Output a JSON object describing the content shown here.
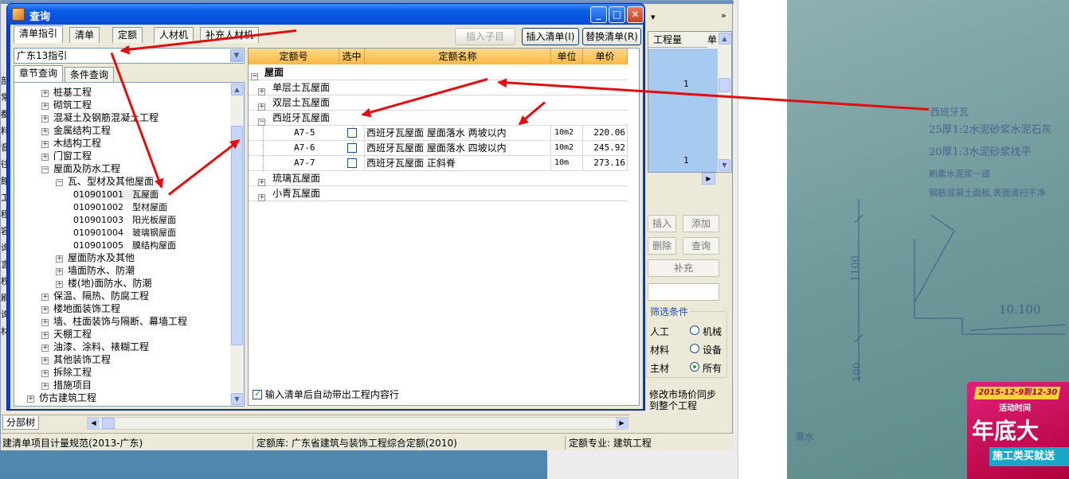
{
  "dialog": {
    "title": "查询",
    "tabs": [
      "清单指引",
      "清单",
      "定额",
      "人材机",
      "补充人材机"
    ],
    "buttons": {
      "insert_child": "插入子目",
      "insert_list": "插入清单(I)",
      "replace_list": "替换清单(R)"
    },
    "combo_value": "广东13指引",
    "subtabs": [
      "章节查询",
      "条件查询"
    ],
    "tree": [
      {
        "label": "桩基工程",
        "level": 1,
        "sign": "+"
      },
      {
        "label": "砌筑工程",
        "level": 1,
        "sign": "+"
      },
      {
        "label": "混凝土及钢筋混凝土工程",
        "level": 1,
        "sign": "+"
      },
      {
        "label": "金属结构工程",
        "level": 1,
        "sign": "+"
      },
      {
        "label": "木结构工程",
        "level": 1,
        "sign": "+"
      },
      {
        "label": "门窗工程",
        "level": 1,
        "sign": "+"
      },
      {
        "label": "屋面及防水工程",
        "level": 1,
        "sign": "-"
      },
      {
        "label": "瓦、型材及其他屋面",
        "level": 2,
        "sign": "-"
      },
      {
        "label": "010901001　瓦屋面",
        "level": 3,
        "sign": "",
        "selected": true
      },
      {
        "label": "010901002　型材屋面",
        "level": 3,
        "sign": ""
      },
      {
        "label": "010901003　阳光板屋面",
        "level": 3,
        "sign": ""
      },
      {
        "label": "010901004　玻璃钢屋面",
        "level": 3,
        "sign": ""
      },
      {
        "label": "010901005　膜结构屋面",
        "level": 3,
        "sign": ""
      },
      {
        "label": "屋面防水及其他",
        "level": 2,
        "sign": "+"
      },
      {
        "label": "墙面防水、防潮",
        "level": 2,
        "sign": "+"
      },
      {
        "label": "楼(地)面防水、防潮",
        "level": 2,
        "sign": "+"
      },
      {
        "label": "保温、隔热、防腐工程",
        "level": 1,
        "sign": "+"
      },
      {
        "label": "楼地面装饰工程",
        "level": 1,
        "sign": "+"
      },
      {
        "label": "墙、柱面装饰与隔断、幕墙工程",
        "level": 1,
        "sign": "+"
      },
      {
        "label": "天棚工程",
        "level": 1,
        "sign": "+"
      },
      {
        "label": "油漆、涂料、裱糊工程",
        "level": 1,
        "sign": "+"
      },
      {
        "label": "其他装饰工程",
        "level": 1,
        "sign": "+"
      },
      {
        "label": "拆除工程",
        "level": 1,
        "sign": "+"
      },
      {
        "label": "措施项目",
        "level": 1,
        "sign": "+"
      },
      {
        "label": "仿古建筑工程",
        "level": 0,
        "sign": "+"
      }
    ],
    "grid_headers": [
      "定额号",
      "选中",
      "定额名称",
      "单位",
      "单价"
    ],
    "grid_root": "屋面",
    "groups": [
      "单层土瓦屋面",
      "双层土瓦屋面",
      "西班牙瓦屋面",
      "琉璃瓦屋面",
      "小青瓦屋面"
    ],
    "rows": [
      {
        "code": "A7-5",
        "name": "西班牙瓦屋面 屋面落水 两坡以内",
        "unit": "10m2",
        "price": "220.06"
      },
      {
        "code": "A7-6",
        "name": "西班牙瓦屋面 屋面落水 四坡以内",
        "unit": "10m2",
        "price": "245.92"
      },
      {
        "code": "A7-7",
        "name": "西班牙瓦屋面 正斜脊",
        "unit": "10m",
        "price": "273.16"
      }
    ],
    "auto_check_label": "输入清单后自动带出工程内容行"
  },
  "main": {
    "grid_header": "工程量",
    "grid_header2": "单",
    "grid_values": [
      "1",
      "1"
    ],
    "side_buttons": [
      "插入",
      "添加",
      "删除",
      "查询",
      "补充"
    ],
    "filter_title": "筛选条件",
    "filter_left": [
      "人工",
      "材料",
      "主材"
    ],
    "filter_right": [
      "机械",
      "设备",
      "所有"
    ],
    "modify_text": [
      "修改市场价同步",
      "到整个工程"
    ],
    "tab_label": "分部树",
    "status": [
      "建清单项目计量规范(2013-广东)",
      "定额库: 广东省建筑与装饰工程综合定额(2010)",
      "定额专业: 建筑工程"
    ],
    "left_chars": [
      "部",
      "常",
      "都",
      "料",
      "音",
      "往",
      "館",
      "工",
      "程",
      "容",
      "询",
      "言",
      "权",
      "刷",
      "询",
      "材",
      "高",
      "建"
    ]
  },
  "photo": {
    "lines": [
      "西班牙瓦",
      "25厚1:2水泥砂浆水泥石灰",
      "20厚1:3水泥砂浆找平",
      "刷素水泥浆一道",
      "钢筋混凝土面板,表面清扫干净"
    ],
    "dims": [
      "1100",
      "100",
      "10.100"
    ],
    "promo_date": "2015-12-9到12-30",
    "promo_sub": "活动时间",
    "promo_big": "年底大",
    "promo_small": "施工类买就送",
    "floor_label": "滴水"
  },
  "colors": {
    "title_blue": "#0548d8",
    "arrow_red": "#e01010",
    "header_orange": "#f8b840",
    "selected_blue": "#a6caf0"
  }
}
